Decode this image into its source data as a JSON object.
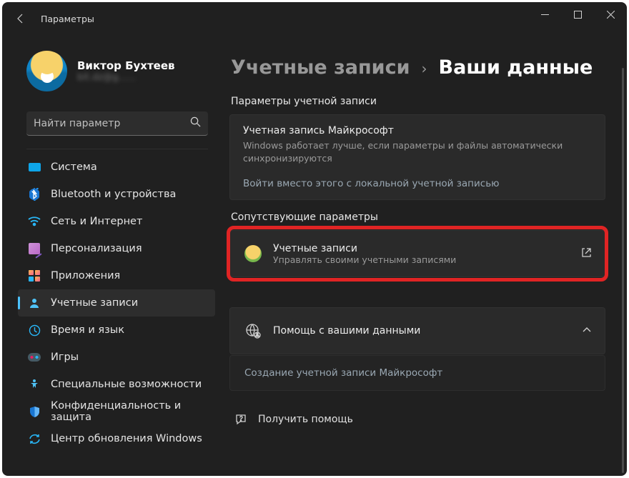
{
  "window": {
    "title": "Параметры"
  },
  "user": {
    "name": "Виктор Бухтеев",
    "email": "bit.dz@g......"
  },
  "search": {
    "placeholder": "Найти параметр"
  },
  "nav": {
    "system": "Система",
    "bluetooth": "Bluetooth и устройства",
    "network": "Сеть и Интернет",
    "personalization": "Персонализация",
    "apps": "Приложения",
    "accounts": "Учетные записи",
    "time_lang": "Время и язык",
    "gaming": "Игры",
    "accessibility": "Специальные возможности",
    "privacy": "Конфиденциальность и защита",
    "update": "Центр обновления Windows"
  },
  "breadcrumb": {
    "parent": "Учетные записи",
    "sep": "›",
    "current": "Ваши данные"
  },
  "sections": {
    "account_params": "Параметры учетной записи",
    "related": "Сопутствующие параметры"
  },
  "ms_account": {
    "title": "Учетная запись Майкрософт",
    "subtitle": "Windows работает лучше, если параметры и файлы автоматически синхронизируются",
    "link": "Войти вместо этого с локальной учетной записью"
  },
  "accounts_card": {
    "title": "Учетные записи",
    "subtitle": "Управлять своими учетными записями"
  },
  "help_data": {
    "title": "Помощь с вашими данными"
  },
  "create_account": {
    "label": "Создание учетной записи Майкрософт"
  },
  "get_help": {
    "label": "Получить помощь"
  }
}
